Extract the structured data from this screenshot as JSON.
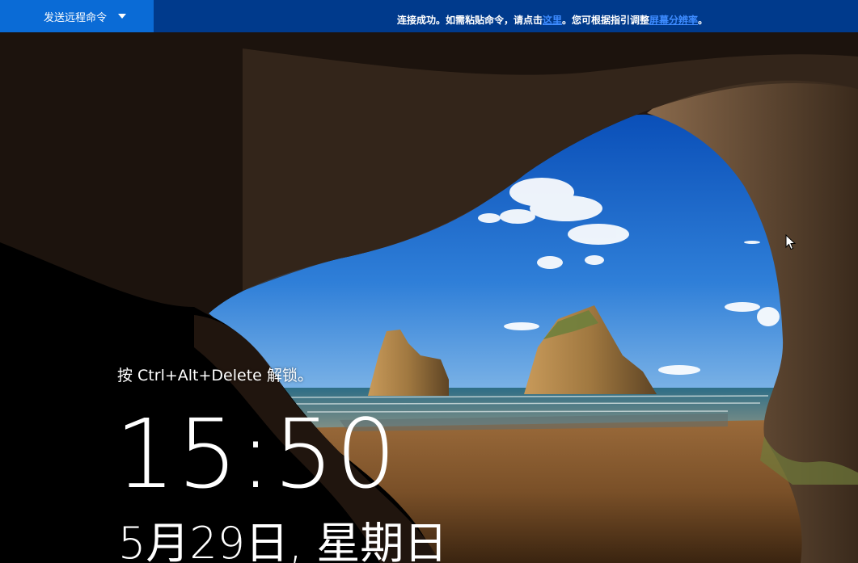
{
  "toolbar": {
    "send_command_label": "发送远程命令",
    "notice_prefix": "连接成功。如需粘贴命令，请点击",
    "notice_link_here": "这里",
    "notice_middle": "。您可根据指引调整",
    "notice_link_resolution": "屏幕分辨率",
    "notice_suffix": "。"
  },
  "lock_screen": {
    "unlock_hint": "按 Ctrl+Alt+Delete 解锁。",
    "time": "15:50",
    "date": "5月29日, 星期日"
  },
  "colors": {
    "toolbar_bg": "#003a8c",
    "send_command_bg": "#0a6bd6",
    "link": "#3d8bff"
  }
}
